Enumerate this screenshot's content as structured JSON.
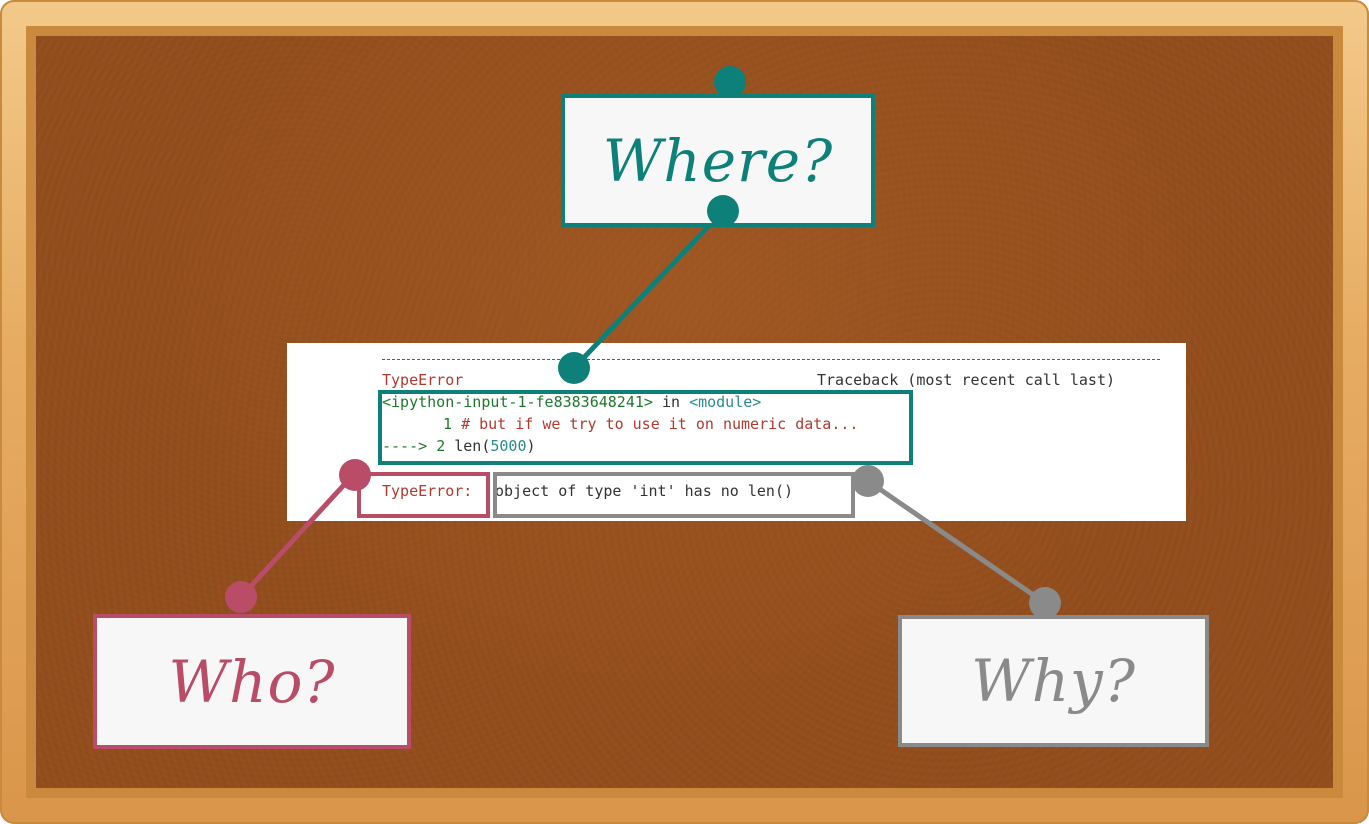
{
  "colors": {
    "teal": "#0d8079",
    "pink": "#b94d67",
    "gray": "#8a8a8a",
    "error_red": "#b03a2e"
  },
  "labels": {
    "where": "Where?",
    "who": "Who?",
    "why": "Why?"
  },
  "traceback": {
    "error_name": "TypeError",
    "header_right": "Traceback (most recent call last)",
    "location": "<ipython-input-1-fe8383648241>",
    "in_word": "in",
    "module": "<module>",
    "line1_num": "1",
    "line1_code": "# but if we try to use it on numeric data...",
    "arrow": "---->",
    "line2_num": "2",
    "line2_func": "len(",
    "line2_arg": "5000",
    "line2_close": ")",
    "final_error_name": "TypeError:",
    "final_message": "object of type 'int' has no len()"
  }
}
